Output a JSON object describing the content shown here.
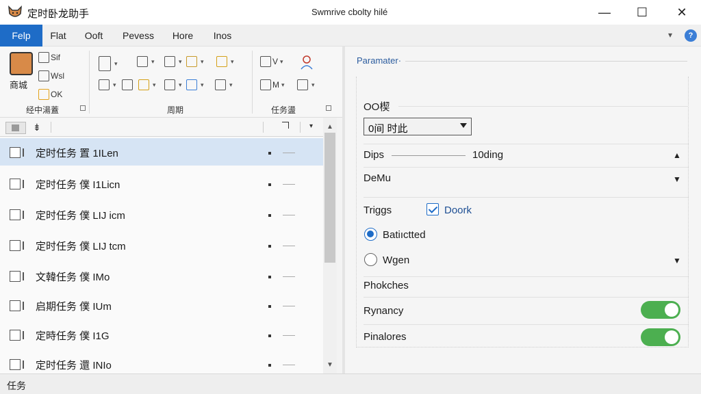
{
  "app": {
    "name": "定时卧龙助手",
    "window_title": "Swmrive cbolty hilé",
    "controls": {
      "minimize": "—",
      "maximize": "☐",
      "close": "✕"
    }
  },
  "menu": {
    "tabs": [
      {
        "label": "Felp",
        "active": true
      },
      {
        "label": "Flat"
      },
      {
        "label": "Ooft"
      },
      {
        "label": "Pevess"
      },
      {
        "label": "Hore"
      },
      {
        "label": "Inos"
      }
    ],
    "collapse_glyph": "▾",
    "help_glyph": "?"
  },
  "ribbon": {
    "big_button_label": "商城",
    "items": [
      "Sif",
      "Wsl",
      "OK",
      "V",
      "M"
    ],
    "groups": [
      "经中湯蓋",
      "周期",
      "任务盪"
    ]
  },
  "task_list": {
    "header_sort_glyph": "⇟",
    "rows": [
      {
        "label": "定时任务 置 1ILen",
        "selected": true
      },
      {
        "label": "定时任务 僕 I1Licn"
      },
      {
        "label": "定时任务 僕 LIJ icm"
      },
      {
        "label": "定时任务 僕 LIJ tcm"
      },
      {
        "label": "文韓任务 僕 IMo"
      },
      {
        "label": "启期任务 僕 IUm"
      },
      {
        "label": "定時任务 僕 I1G"
      },
      {
        "label": "定时任务 還 INIo"
      }
    ]
  },
  "status": {
    "text": "任务"
  },
  "parameters": {
    "legend": "Paramater·",
    "field1_label": "OO楔",
    "field1_select_value": "0间 时此",
    "dips_label": "Dips",
    "dips_value": "10ding",
    "demu_label": "DeMu",
    "triggs_label": "Triggs",
    "doork_label": "Doork",
    "doork_checked": true,
    "radio1_label": "Batiıctted",
    "radio1_checked": true,
    "radio2_label": "Wgen",
    "radio2_checked": false,
    "phokches_label": "Phokches",
    "rynancy_label": "Rynancy",
    "rynancy_on": true,
    "pinalores_label": "Pinalores",
    "pinalores_on": true
  }
}
